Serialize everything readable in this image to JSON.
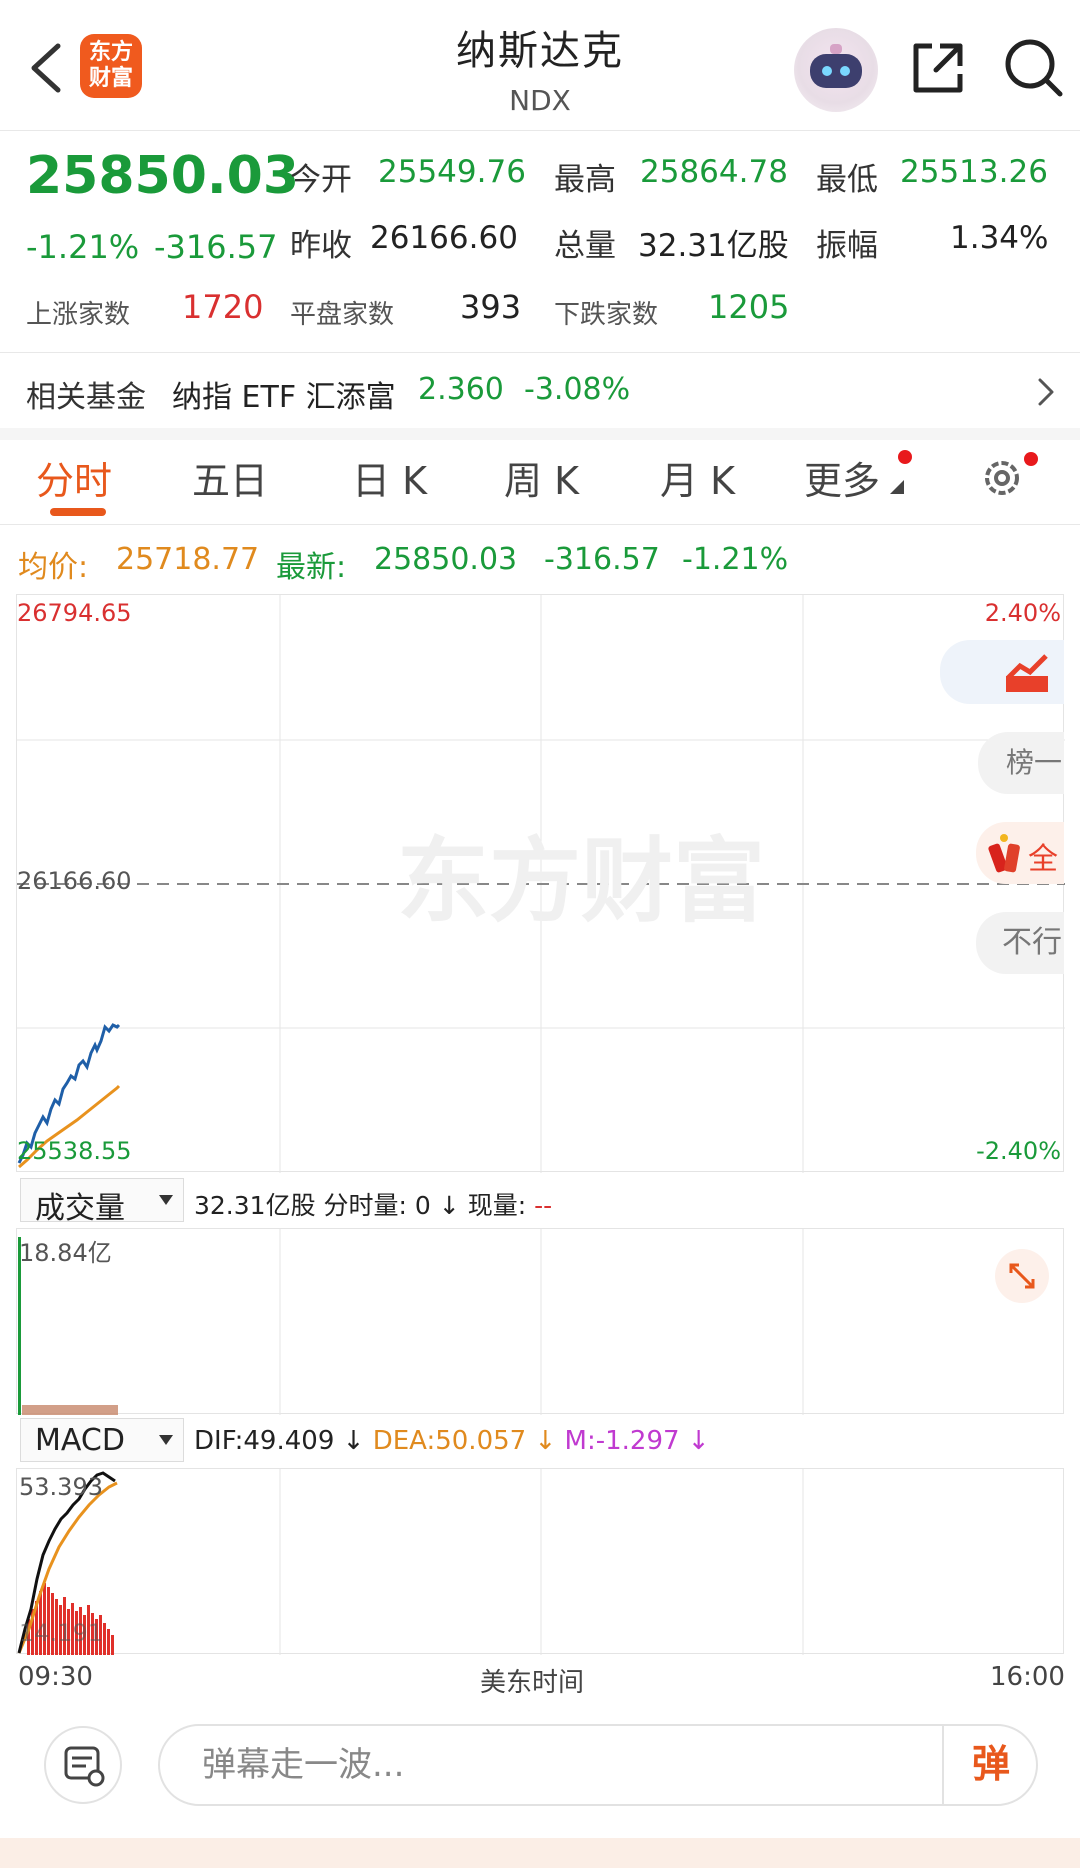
{
  "header": {
    "title": "纳斯达克",
    "subtitle": "NDX",
    "logo_text": "东方\n财富"
  },
  "quote": {
    "price": "25850.03",
    "change_pct": "-1.21%",
    "change": "-316.57",
    "open_label": "今开",
    "open": "25549.76",
    "high_label": "最高",
    "high": "25864.78",
    "low_label": "最低",
    "low": "25513.26",
    "prev_close_label": "昨收",
    "prev_close": "26166.60",
    "volume_label": "总量",
    "volume": "32.31亿股",
    "amplitude_label": "振幅",
    "amplitude": "1.34%",
    "up_label": "上涨家数",
    "up_count": "1720",
    "flat_label": "平盘家数",
    "flat_count": "393",
    "down_label": "下跌家数",
    "down_count": "1205"
  },
  "fund": {
    "label": "相关基金",
    "name": "纳指 ETF 汇添富",
    "price": "2.360",
    "change": "-3.08%"
  },
  "tabs": [
    {
      "label": "分时"
    },
    {
      "label": "五日"
    },
    {
      "label": "日 K"
    },
    {
      "label": "周 K"
    },
    {
      "label": "月 K"
    },
    {
      "label": "更多"
    }
  ],
  "chart_info": {
    "avg_label": "均价:",
    "avg": "25718.77",
    "latest_label": "最新:",
    "latest": "25850.03",
    "latest_change": "-316.57",
    "latest_pct": "-1.21%"
  },
  "main_chart": {
    "y_top": "26794.65",
    "y_mid": "26166.60",
    "y_bottom": "25538.55",
    "pct_top": "2.40%",
    "pct_bottom": "-2.40%",
    "watermark": "东方财富"
  },
  "side_pills": {
    "rank": "榜一",
    "all": "全",
    "no": "不行"
  },
  "volume_panel": {
    "selector": "成交量",
    "total": "32.31亿股",
    "minute_label": "分时量:",
    "minute_value": "0",
    "now_label": "现量:",
    "now_value": "--",
    "y_top": "18.84亿"
  },
  "macd_panel": {
    "selector": "MACD",
    "dif": "DIF:49.409",
    "dea": "DEA:50.057",
    "m": "M:-1.297",
    "y_top": "53.393",
    "y_bottom": "14.191"
  },
  "time_axis": {
    "start": "09:30",
    "mid": "美东时间",
    "end": "16:00"
  },
  "bottom": {
    "input_placeholder": "弹幕走一波...",
    "danmu_label": "弹"
  },
  "colors": {
    "up": "#d93030",
    "down": "#1a9a3a",
    "accent": "#e8581c",
    "price_line": "#1f5fa8",
    "avg_line": "#e8921e"
  }
}
